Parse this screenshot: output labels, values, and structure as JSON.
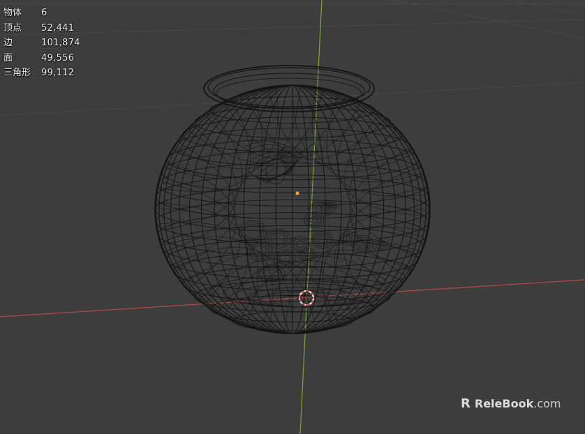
{
  "viewport": {
    "background": "#3d3d3d",
    "grid_color": "#4a4a4a",
    "x_axis_color": "#b04a4a",
    "y_axis_color": "#7fa53a",
    "wire_color": "#141414",
    "origin_dot_color": "#f0a030",
    "cursor_color": "#e05050",
    "cursor_ring_color": "#ffffff"
  },
  "stats": [
    {
      "label": "物体",
      "value": "6"
    },
    {
      "label": "顶点",
      "value": "52,441"
    },
    {
      "label": "边",
      "value": "101,874"
    },
    {
      "label": "面",
      "value": "49,556"
    },
    {
      "label": "三角形",
      "value": "99,112"
    }
  ],
  "watermark": {
    "logo": "R",
    "name": "ReleBook",
    "domain": ".com"
  }
}
